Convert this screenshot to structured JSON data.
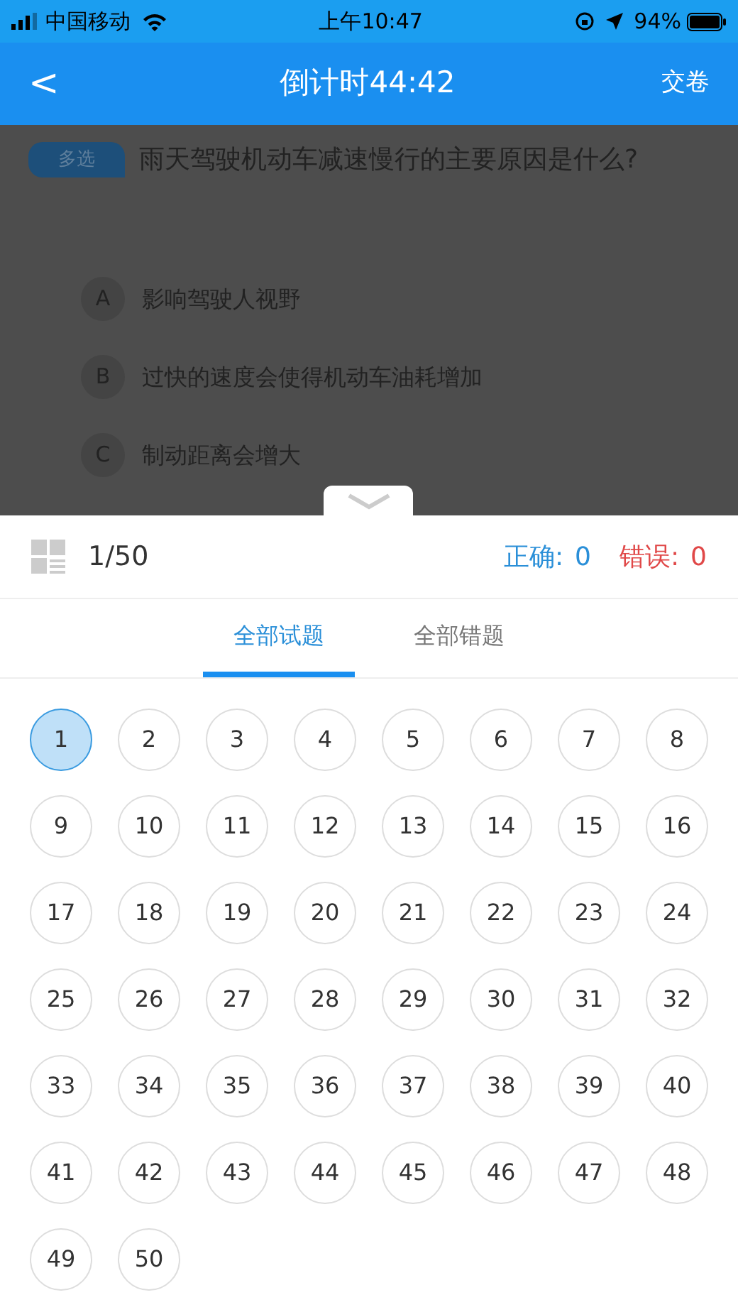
{
  "status_bar": {
    "carrier": "中国移动",
    "time": "上午10:47",
    "battery": "94%"
  },
  "nav": {
    "back": "<",
    "title": "倒计时44:42",
    "action": "交卷"
  },
  "question": {
    "type_tag": "多选",
    "text": "雨天驾驶机动车减速慢行的主要原因是什么?",
    "options": [
      {
        "letter": "A",
        "text": "影响驾驶人视野"
      },
      {
        "letter": "B",
        "text": "过快的速度会使得机动车油耗增加"
      },
      {
        "letter": "C",
        "text": "制动距离会增大"
      }
    ]
  },
  "panel": {
    "progress": "1/50",
    "correct_label": "正确:",
    "correct_count": "0",
    "wrong_label": "错误:",
    "wrong_count": "0",
    "tabs": [
      {
        "label": "全部试题",
        "selected": true
      },
      {
        "label": "全部错题",
        "selected": false
      }
    ],
    "questions": [
      {
        "label": "1",
        "selected": true
      },
      {
        "label": "2",
        "selected": false
      },
      {
        "label": "3",
        "selected": false
      },
      {
        "label": "4",
        "selected": false
      },
      {
        "label": "5",
        "selected": false
      },
      {
        "label": "6",
        "selected": false
      },
      {
        "label": "7",
        "selected": false
      },
      {
        "label": "8",
        "selected": false
      },
      {
        "label": "9",
        "selected": false
      },
      {
        "label": "10",
        "selected": false
      },
      {
        "label": "11",
        "selected": false
      },
      {
        "label": "12",
        "selected": false
      },
      {
        "label": "13",
        "selected": false
      },
      {
        "label": "14",
        "selected": false
      },
      {
        "label": "15",
        "selected": false
      },
      {
        "label": "16",
        "selected": false
      },
      {
        "label": "17",
        "selected": false
      },
      {
        "label": "18",
        "selected": false
      },
      {
        "label": "19",
        "selected": false
      },
      {
        "label": "20",
        "selected": false
      },
      {
        "label": "21",
        "selected": false
      },
      {
        "label": "22",
        "selected": false
      },
      {
        "label": "23",
        "selected": false
      },
      {
        "label": "24",
        "selected": false
      },
      {
        "label": "25",
        "selected": false
      },
      {
        "label": "26",
        "selected": false
      },
      {
        "label": "27",
        "selected": false
      },
      {
        "label": "28",
        "selected": false
      },
      {
        "label": "29",
        "selected": false
      },
      {
        "label": "30",
        "selected": false
      },
      {
        "label": "31",
        "selected": false
      },
      {
        "label": "32",
        "selected": false
      },
      {
        "label": "33",
        "selected": false
      },
      {
        "label": "34",
        "selected": false
      },
      {
        "label": "35",
        "selected": false
      },
      {
        "label": "36",
        "selected": false
      },
      {
        "label": "37",
        "selected": false
      },
      {
        "label": "38",
        "selected": false
      },
      {
        "label": "39",
        "selected": false
      },
      {
        "label": "40",
        "selected": false
      },
      {
        "label": "41",
        "selected": false
      },
      {
        "label": "42",
        "selected": false
      },
      {
        "label": "43",
        "selected": false
      },
      {
        "label": "44",
        "selected": false
      },
      {
        "label": "45",
        "selected": false
      },
      {
        "label": "46",
        "selected": false
      },
      {
        "label": "47",
        "selected": false
      },
      {
        "label": "48",
        "selected": false
      },
      {
        "label": "49",
        "selected": false
      },
      {
        "label": "50",
        "selected": false
      }
    ]
  }
}
